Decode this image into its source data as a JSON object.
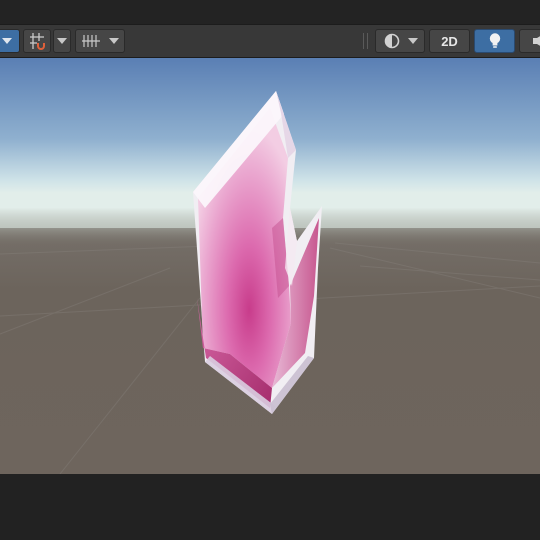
{
  "toolbar": {
    "left_tools": [
      {
        "name": "view-options-dropdown",
        "icon": "dropdown-icon"
      },
      {
        "name": "snap-toggle",
        "icon": "grid-snap-icon"
      },
      {
        "name": "grid-settings-dropdown",
        "icon": "grid-icon"
      }
    ],
    "right_tools": [
      {
        "name": "draw-mode-dropdown",
        "icon": "shading-sphere-icon"
      },
      {
        "name": "toggle-2d-button",
        "label": "2D"
      },
      {
        "name": "lighting-toggle",
        "icon": "light-bulb-icon",
        "active": true
      },
      {
        "name": "audio-toggle",
        "icon": "speaker-icon"
      }
    ],
    "two_d_label": "2D"
  },
  "viewport": {
    "object": "pink crystal",
    "colors": {
      "sky_top": "#5a7fb4",
      "horizon": "#d9e8e6",
      "ground": "#6e655c",
      "crystal_edge": "#f2eef4",
      "crystal_core": "#d44a96",
      "accent_active": "#3d6ea3"
    }
  }
}
